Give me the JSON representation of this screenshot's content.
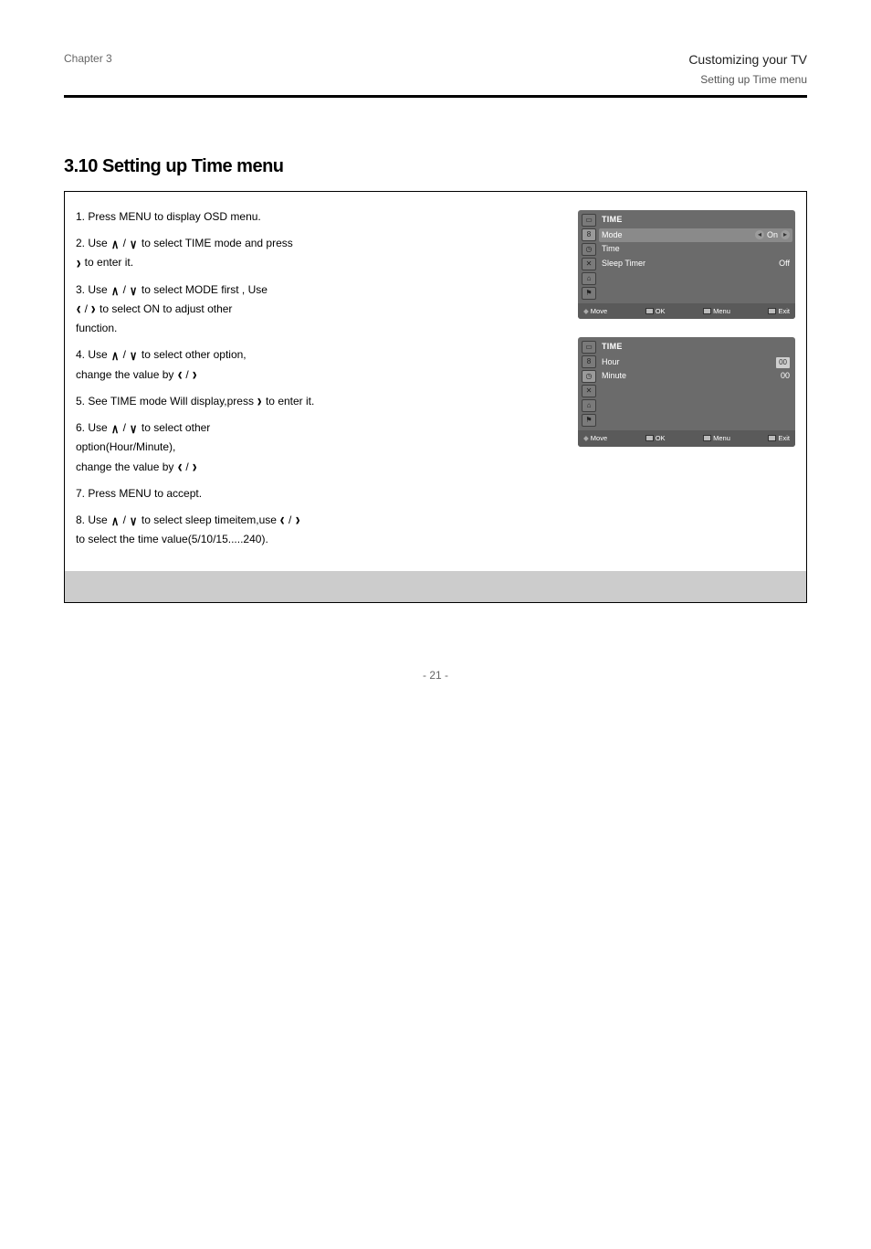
{
  "header": {
    "chapter": "Chapter 3",
    "title": "Customizing your TV",
    "subtitle": "Setting up Time menu"
  },
  "section": {
    "title": "3.10 Setting up Time menu"
  },
  "steps": [
    {
      "num": "1.",
      "text": "Press MENU to display OSD menu."
    },
    {
      "num": "2.",
      "segments": [
        "Use ",
        "UP",
        " / ",
        "DOWN",
        " to select TIME mode and press ",
        "RIGHT",
        " to enter it."
      ]
    },
    {
      "num": "3.",
      "segments": [
        "Use ",
        "UP",
        " / ",
        "DOWN",
        " to select MODE first , Use ",
        "LEFT",
        " / ",
        "RIGHT",
        " to select ON to adjust other function."
      ]
    },
    {
      "num": "4.",
      "segments": [
        "Use ",
        "UP",
        " / ",
        "DOWN",
        " to select other option, change the value by ",
        "LEFT",
        " / ",
        "RIGHT"
      ]
    },
    {
      "num": "5.",
      "text_before": "See TIME mode Will display,press ",
      "text_after": " to enter it."
    },
    {
      "num": "6.",
      "segments": [
        "Use ",
        "UP",
        " / ",
        "DOWN",
        " to select other option(Hour/Minute), change the value by ",
        "LEFT",
        " / ",
        "RIGHT"
      ]
    },
    {
      "num": "7.",
      "text": "Press MENU to accept."
    },
    {
      "num": "8.",
      "segments": [
        "Use ",
        "UP",
        " / ",
        "DOWN",
        " to select sleep timeitem,use ",
        "LEFT",
        " / ",
        "RIGHT",
        " to select the time value(5/10/15.....240)."
      ]
    }
  ],
  "osd1": {
    "title": "TIME",
    "icons": [
      "pic",
      "ch",
      "clock",
      "tools",
      "lock",
      "flag"
    ],
    "selected_icon": 1,
    "rows": [
      {
        "label": "Mode",
        "value": "On",
        "selected": true,
        "arrows": true
      },
      {
        "label": "Time",
        "value": ""
      },
      {
        "label": "Sleep Timer",
        "value": "Off"
      }
    ],
    "footer": {
      "move": "Move",
      "f1": "OK",
      "f2": "Menu",
      "f3": "Exit"
    }
  },
  "osd2": {
    "title": "TIME",
    "icons": [
      "pic",
      "ch",
      "clock",
      "tools",
      "lock",
      "flag"
    ],
    "selected_icon": 2,
    "rows": [
      {
        "label": "Hour",
        "value": "00",
        "input": true
      },
      {
        "label": "Minute",
        "value": "00"
      }
    ],
    "footer": {
      "move": "Move",
      "f1": "OK",
      "f2": "Menu",
      "f3": "Exit"
    }
  },
  "pager": "- 21 -"
}
